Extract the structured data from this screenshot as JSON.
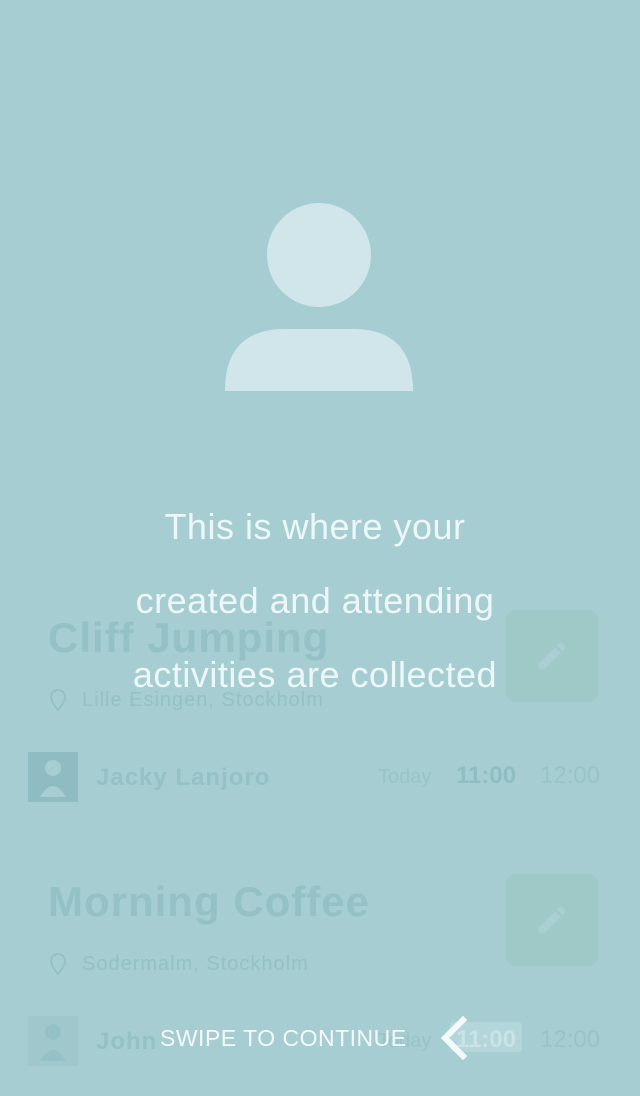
{
  "app": {
    "accent_color": "#a5cdd2",
    "overlay_text_color": "#eef7f8"
  },
  "activities": [
    {
      "title": "Cliff Jumping",
      "location": "Lille Esingen, Stockholm",
      "host": "Jacky Lanjoro",
      "day": "Today",
      "time_start": "11:00",
      "time_end": "12:00"
    },
    {
      "title": "Morning Coffee",
      "location": "Sodermalm, Stockholm",
      "host": "John",
      "day": "Today",
      "time_start": "11:00",
      "time_end": "12:00"
    }
  ],
  "onboarding": {
    "icon": "user-profile-icon",
    "message_lines": [
      "This is where your",
      "created and attending",
      "activities are collected"
    ],
    "swipe_label": "SWIPE TO CONTINUE",
    "swipe_icon": "chevron-left-icon"
  }
}
